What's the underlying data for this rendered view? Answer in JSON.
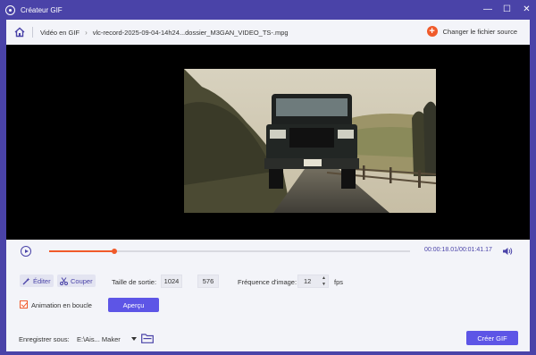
{
  "window": {
    "title": "Créateur GIF",
    "controls": [
      "minimize-icon",
      "maximize-icon",
      "close-icon"
    ]
  },
  "breadcrumb": {
    "section": "Vidéo en GIF",
    "file": "vlc-record-2025-09-04-14h24...dossier_M3GAN_VIDEO_TS-.mpg",
    "change_source": "Changer le fichier source"
  },
  "playback": {
    "current_time": "00:00:18.01",
    "separator": "/",
    "total_time": "00:01:41.17",
    "progress_fraction": 0.18
  },
  "tools": {
    "edit_label": "Éditer",
    "cut_label": "Couper"
  },
  "output": {
    "size_label": "Taille de sortie:",
    "width": "1024",
    "height": "576",
    "frame_rate_label": "Fréquence d'image:",
    "frame_rate": "12",
    "fps_unit": "fps",
    "loop_label": "Animation en boucle",
    "loop_checked": true,
    "preview_label": "Aperçu"
  },
  "save": {
    "label": "Enregistrer sous:",
    "path": "E:\\Ais... Maker",
    "create_label": "Créer GIF"
  },
  "colors": {
    "accent": "#4a43a8",
    "button": "#5d55e6",
    "orange": "#f05a2a"
  }
}
